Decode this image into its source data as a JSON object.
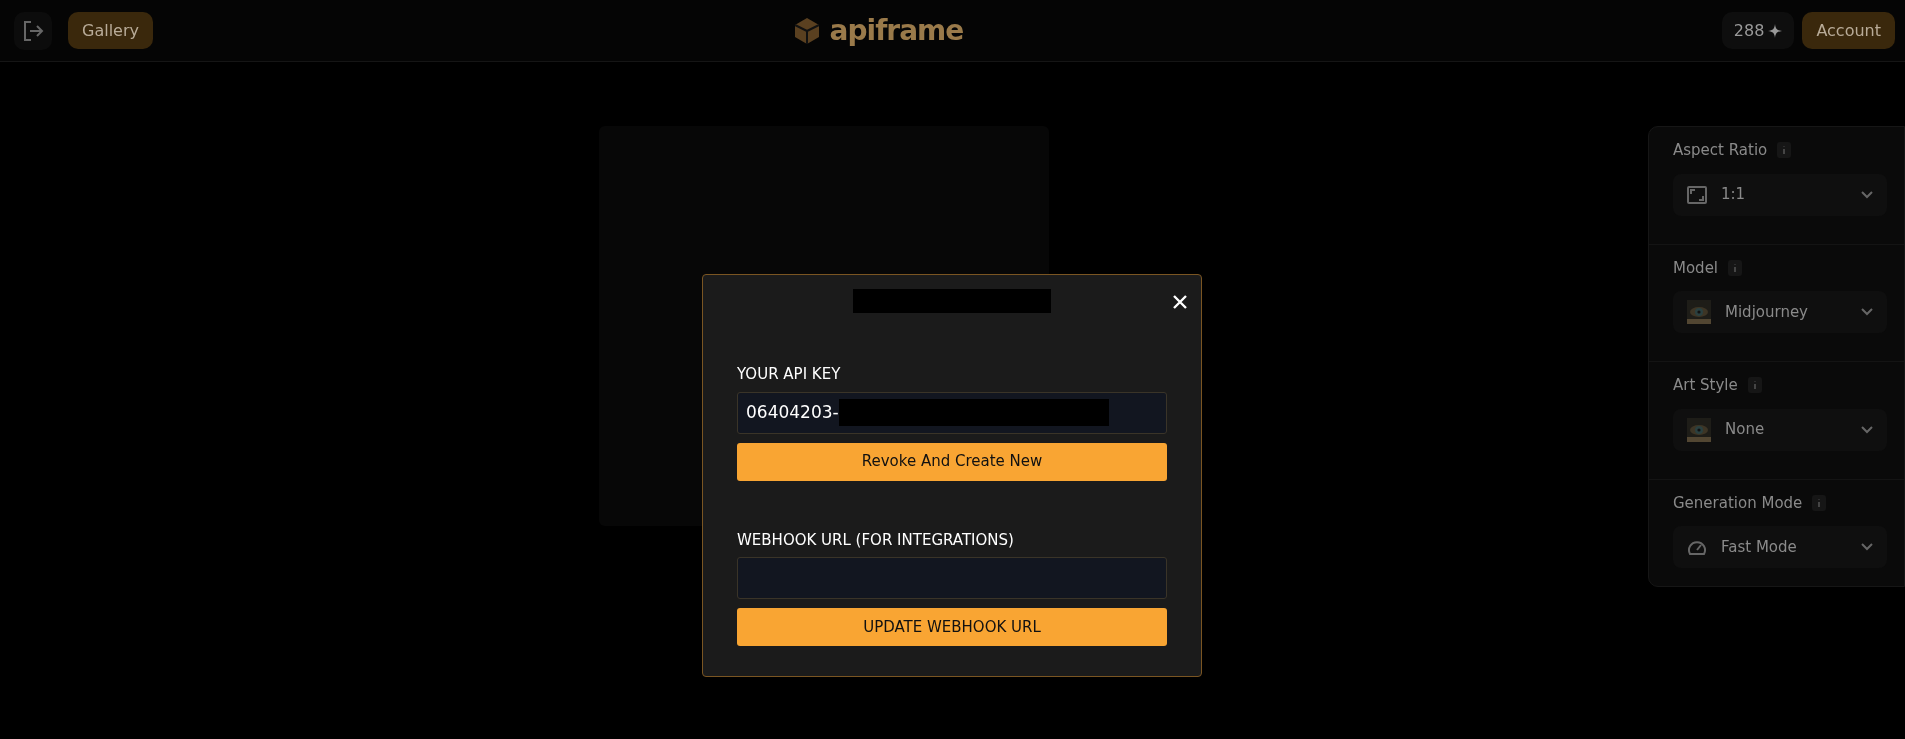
{
  "header": {
    "gallery_button": "Gallery",
    "logo": "apiframe",
    "credits": "288",
    "account_button": "Account"
  },
  "settings": [
    {
      "label": "Aspect Ratio",
      "value": "1:1",
      "kind": "aspect"
    },
    {
      "label": "Model",
      "value": "Midjourney",
      "kind": "picture"
    },
    {
      "label": "Art Style",
      "value": "None",
      "kind": "picture"
    },
    {
      "label": "Generation Mode",
      "value": "Fast Mode",
      "kind": "gauge"
    }
  ],
  "modal": {
    "api_key_label": "YOUR API KEY",
    "api_key_value": "06404203-",
    "revoke_button": "Revoke And Create New",
    "webhook_label": "WEBHOOK URL (FOR INTEGRATIONS)",
    "update_button": "UPDATE WEBHOOK URL"
  }
}
